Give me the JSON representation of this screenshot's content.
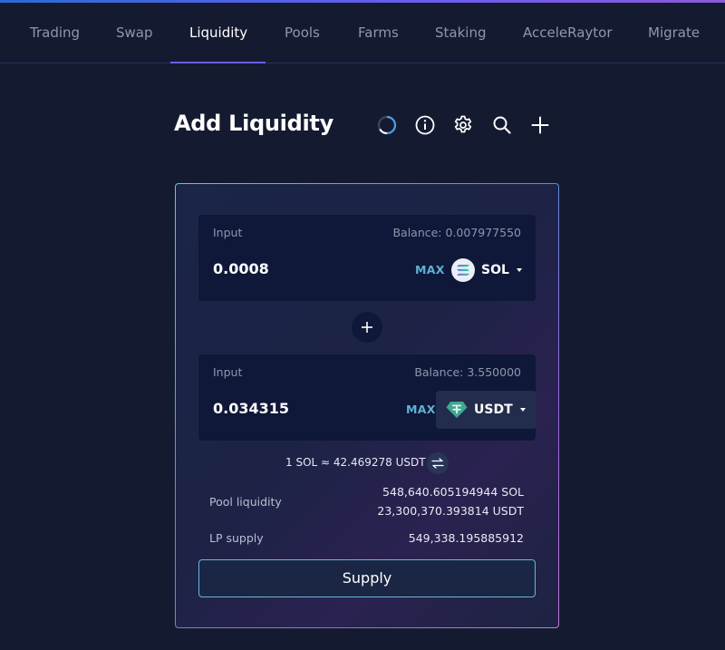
{
  "nav": {
    "items": [
      {
        "label": "Trading"
      },
      {
        "label": "Swap"
      },
      {
        "label": "Liquidity"
      },
      {
        "label": "Pools"
      },
      {
        "label": "Farms"
      },
      {
        "label": "Staking"
      },
      {
        "label": "AcceleRaytor"
      },
      {
        "label": "Migrate"
      }
    ],
    "active": "Liquidity"
  },
  "page": {
    "title": "Add Liquidity",
    "toolbar_icons": [
      "refresh-progress-icon",
      "info-icon",
      "settings-gear-icon",
      "search-icon",
      "plus-icon"
    ]
  },
  "input_from": {
    "label": "Input",
    "balance": "Balance: 0.007977550",
    "value": "0.0008",
    "max_label": "MAX",
    "token": "SOL"
  },
  "input_to": {
    "label": "Input",
    "balance": "Balance: 3.550000",
    "value": "0.034315",
    "max_label": "MAX",
    "token": "USDT"
  },
  "rate": "1 SOL ≈ 42.469278 USDT",
  "info": {
    "pool_liquidity_label": "Pool liquidity",
    "pool_liquidity_sol": "548,640.605194944 SOL",
    "pool_liquidity_usdt": "23,300,370.393814 USDT",
    "lp_supply_label": "LP supply",
    "lp_supply_value": "549,338.195885912"
  },
  "supply_button": "Supply",
  "colors": {
    "background": "#141b31",
    "panel": "#0f1838",
    "accent_underline": "#6d5de8",
    "max_text": "#5fb2d6",
    "button_border": "#68b7d6"
  }
}
